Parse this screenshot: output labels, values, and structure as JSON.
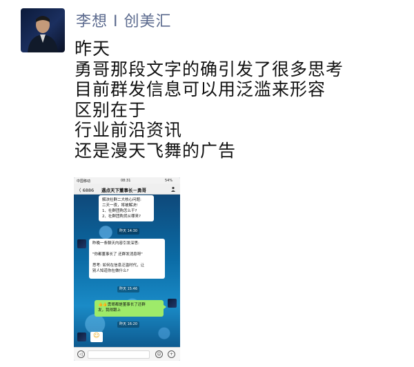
{
  "post": {
    "author": "李想 I 创美汇",
    "lines": [
      "昨天",
      "勇哥那段文字的确引发了很多思考",
      "目前群发信息可以用泛滥来形容",
      "区别在于",
      "行业前沿资讯",
      "还是漫天飞舞的广告"
    ]
  },
  "phone": {
    "status": {
      "carrier": "中国移动",
      "time": "08:31",
      "battery": "54%"
    },
    "nav": {
      "back": "〈 6886",
      "title": "遇点天下董事长－勇哥",
      "more_icon": "person-icon"
    },
    "bubble1": [
      "解决社群二大核心问题:",
      "二天一夜，将被解决!",
      "1、社群团购怎么干?",
      "2、社群团购货从哪来?"
    ],
    "time1": "昨天 14:30",
    "bubble2": [
      "昨晚一条聊天内容引发深思:",
      "",
      "\"你都董事长了 还群发消息呀\"",
      "",
      "思考: 如何在信息泛滥时代，让",
      "别人知道你在做什么?"
    ],
    "time2": "昨天 15:46",
    "green": [
      "👍👍勇哥都是董事长了还群",
      "发，我得跟上"
    ],
    "time3": "昨天 16:20",
    "input_icons": {
      "voice": "◁",
      "emoji": "☺",
      "plus": "+"
    }
  }
}
